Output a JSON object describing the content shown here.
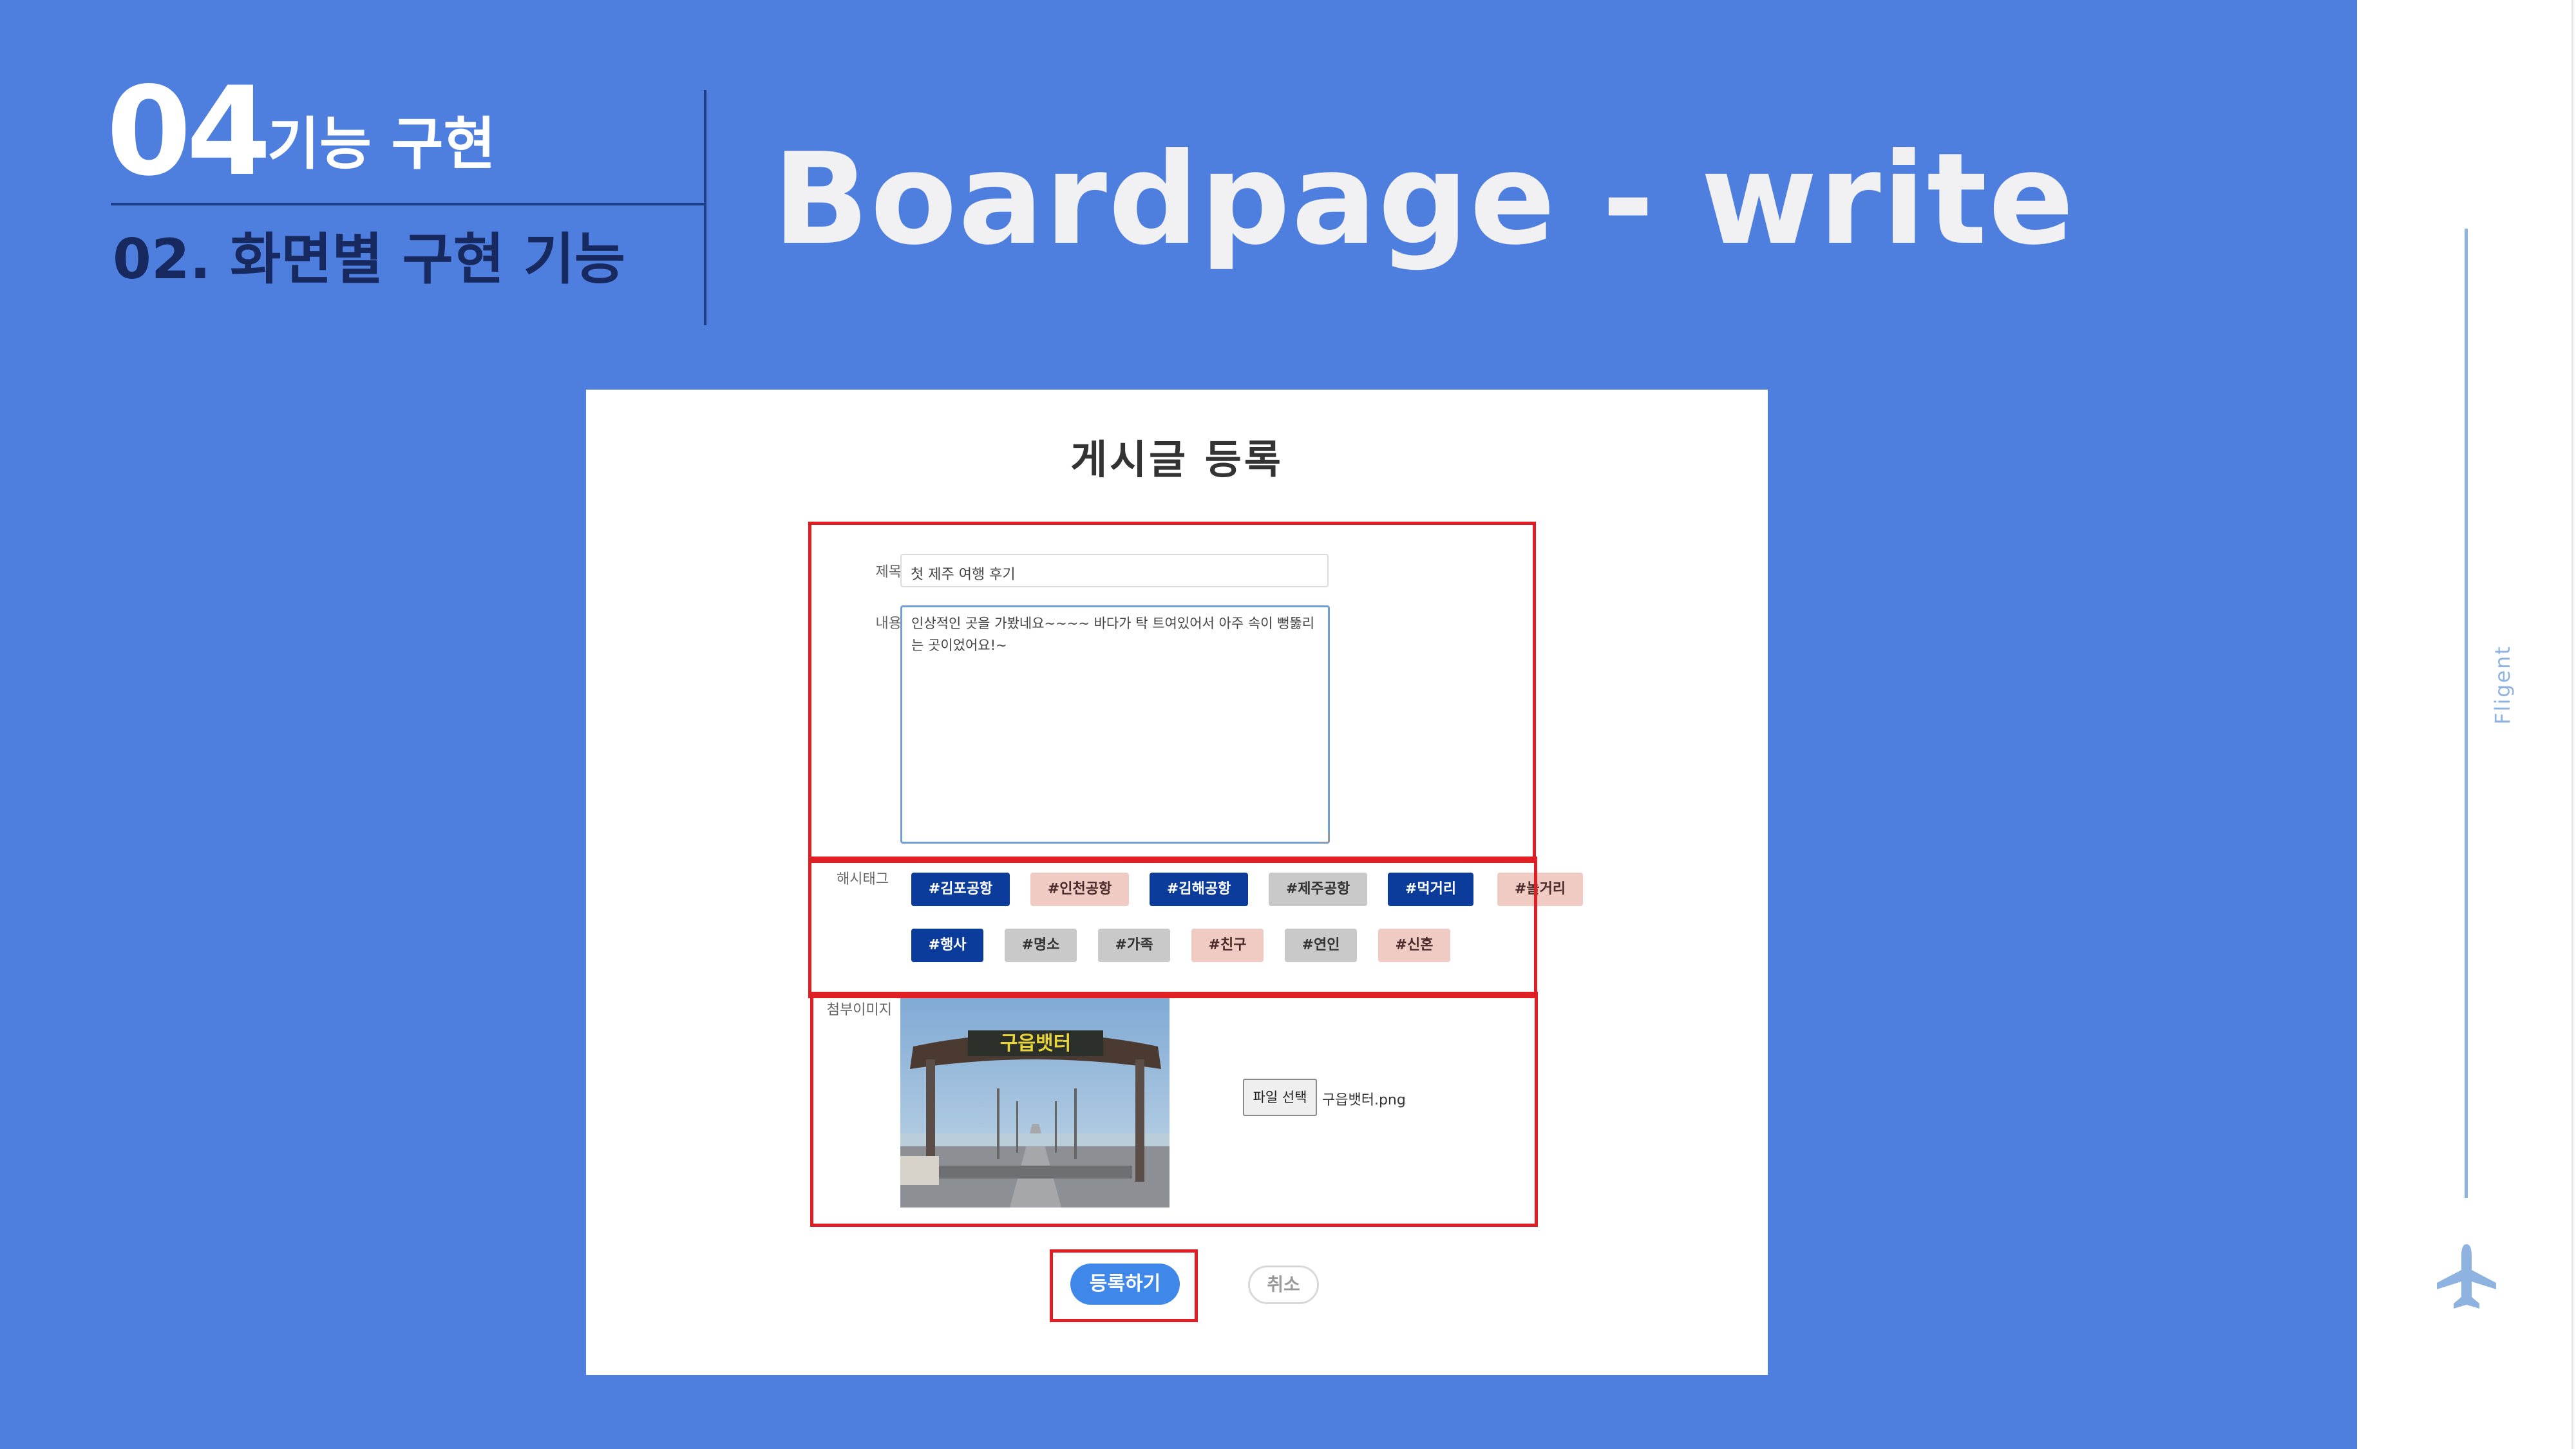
{
  "header": {
    "section_number": "04",
    "section_title": "기능 구현",
    "section_subtitle": "02. 화면별 구현 기능",
    "page_heading": "Boardpage - write"
  },
  "form": {
    "title": "게시글 등록",
    "title_label": "제목",
    "title_value": "첫 제주 여행 후기",
    "content_label": "내용",
    "content_value": "인상적인 곳을 가봤네요~~~~ 바다가 탁 트여있어서 아주 속이 뻥뚫리는 곳이었어요!~",
    "hashtag_label": "해시태그",
    "hashtags": [
      {
        "label": "#김포공항",
        "style": "blue"
      },
      {
        "label": "#인천공항",
        "style": "pink"
      },
      {
        "label": "#김해공항",
        "style": "blue"
      },
      {
        "label": "#제주공항",
        "style": "gray"
      },
      {
        "label": "#먹거리",
        "style": "blue"
      },
      {
        "label": "#놀거리",
        "style": "pink"
      },
      {
        "label": "#행사",
        "style": "blue"
      },
      {
        "label": "#명소",
        "style": "gray"
      },
      {
        "label": "#가족",
        "style": "gray"
      },
      {
        "label": "#친구",
        "style": "pink"
      },
      {
        "label": "#연인",
        "style": "gray"
      },
      {
        "label": "#신혼",
        "style": "pink"
      }
    ],
    "image_label": "첨부이미지",
    "image_sign_text": "구읍뱃터",
    "file_button_label": "파일 선택",
    "file_name": "구읍뱃터.png",
    "submit_label": "등록하기",
    "cancel_label": "취소"
  },
  "rail": {
    "label": "Fligent"
  },
  "colors": {
    "background": "#4e7fde",
    "highlight_box": "#e01f25",
    "tag_blue": "#0b3c9c",
    "tag_pink": "#f0cbc3",
    "tag_gray": "#c9c9c9",
    "submit": "#3f88ea"
  },
  "icons": [
    "airplane-icon"
  ]
}
